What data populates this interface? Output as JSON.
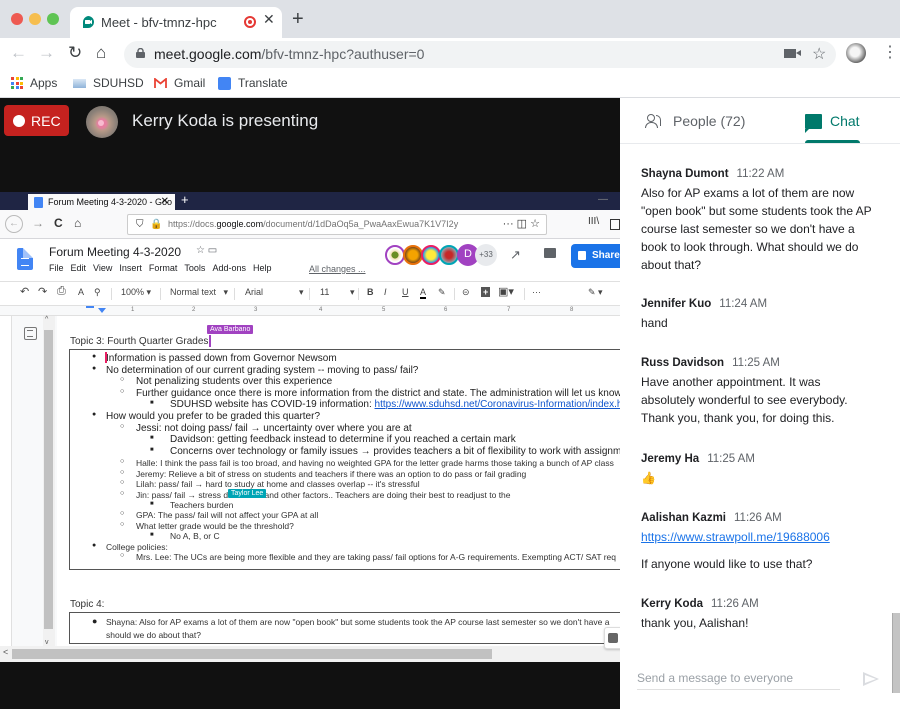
{
  "browser": {
    "tab_title": "Meet - bfv-tmnz-hpc",
    "close_symbol": "✕",
    "new_tab_symbol": "+",
    "url_host": "meet.google.com",
    "url_path": "/bfv-tmnz-hpc?authuser=0",
    "back_symbol": "←",
    "forward_symbol": "→",
    "reload_symbol": "↻",
    "home_symbol": "⌂",
    "star_symbol": "☆",
    "menu_symbol": "⋮",
    "bookmarks": [
      {
        "label": "Apps"
      },
      {
        "label": "SDUHSD"
      },
      {
        "label": "Gmail"
      },
      {
        "label": "Translate"
      }
    ]
  },
  "meet": {
    "rec_label": "REC",
    "presenting_text": "Kerry Koda is presenting",
    "colors": {
      "rec": "#c5221f",
      "accent": "#00796b"
    }
  },
  "shared_screen": {
    "firefox": {
      "tab_title": "Forum Meeting 4-3-2020 - Goo",
      "tab_close": "✕",
      "new_tab": "+",
      "minimize": "—",
      "back": "←",
      "forward": "→",
      "reload": "C",
      "home": "⌂",
      "url_prefix": "https://docs.",
      "url_host": "google.com",
      "url_rest": "/document/d/1dDaOq5a_PwaAaxEwua7K1V7I2y",
      "url_actions": "··· ◫ ☆",
      "library": "III\\"
    },
    "docs": {
      "title": "Forum Meeting 4-3-2020",
      "title_icons": "☆ ▭",
      "menu": [
        "File",
        "Edit",
        "View",
        "Insert",
        "Format",
        "Tools",
        "Add-ons",
        "Help"
      ],
      "all_changes": "All changes ...",
      "collaborators_more": "+33",
      "collaborator_letter": "D",
      "activity_symbol": "↗",
      "share_label": "Share",
      "toolbar": {
        "undo": "↶",
        "redo": "↷",
        "print": "⎙",
        "spell": "A",
        "paint": "⚲",
        "zoom": "100%",
        "style": "Normal text",
        "font": "Arial",
        "size": "11",
        "bold": "B",
        "italic": "I",
        "underline": "U",
        "color": "A",
        "highlight": "✎",
        "link": "⊝",
        "comment": "+",
        "image": "▣",
        "more": "···",
        "edit": "✎"
      },
      "ruler_numbers": [
        "1",
        "2",
        "3",
        "4",
        "5",
        "6",
        "7",
        "8"
      ],
      "topic3_label": "Topic 3:  Fourth Quarter Grades:",
      "topic3_items": [
        {
          "level": 0,
          "text": "Information is passed down from Governor Newsom"
        },
        {
          "level": 0,
          "text": "No determination of our current grading system -- moving to pass/ fail?"
        },
        {
          "level": 1,
          "text": "Not penalizing students over this experience"
        },
        {
          "level": 1,
          "text": "Further guidance once there is more information from the district and state. The administration will let us know"
        },
        {
          "level": 2,
          "text": "SDUHSD website has COVID-19 information: ",
          "link": "https://www.sduhsd.net/Coronavirus-Information/index.html"
        },
        {
          "level": 0,
          "text": "How would you prefer to be graded this quarter?"
        },
        {
          "level": 1,
          "text": "Jessi: not doing pass/ fail → uncertainty over where you are at"
        },
        {
          "level": 2,
          "text": "Davidson: getting feedback instead to determine if you reached a certain mark"
        },
        {
          "level": 2,
          "text": "Concerns over technology or family issues → provides teachers a bit of flexibility to work with assignments"
        },
        {
          "level": 1,
          "small": true,
          "text": "Halle: I think the pass fail is too broad, and having no weighted GPA for the letter grade harms those taking a bunch of AP class"
        },
        {
          "level": 1,
          "small": true,
          "text": "Jeremy: Relieve a bit of stress on students and teachers if there was an option to do pass or fail grading"
        },
        {
          "level": 1,
          "small": true,
          "text": "Lilah: pass/ fail → hard to study at home and classes overlap -- it's stressful"
        },
        {
          "level": 1,
          "small": true,
          "text": "Jin: pass/ fail → stress d            ituations and other factors.. Teachers are doing their best to readjust to the"
        },
        {
          "level": 2,
          "small": true,
          "text": "Teachers burden"
        },
        {
          "level": 1,
          "small": true,
          "text": "GPA: The pass/ fail will not affect your GPA at all"
        },
        {
          "level": 1,
          "small": true,
          "text": "What letter grade would be the threshold?"
        },
        {
          "level": 2,
          "small": true,
          "text": "No A, B, or C"
        },
        {
          "level": 0,
          "small": true,
          "text": "College policies:"
        },
        {
          "level": 1,
          "small": true,
          "text": "Mrs. Lee: The UCs are being more flexible and they are taking pass/ fail options for A-G requirements. Exempting ACT/ SAT req"
        }
      ],
      "topic4_label": "Topic 4:",
      "topic4_items": [
        {
          "text": "Shayna: Also for AP exams a lot of them are now \"open book\" but some students took the AP course last semester so we don't have a"
        },
        {
          "text": "should we do about that?"
        }
      ],
      "cursors": [
        {
          "name": "Ava Barbano",
          "color": "#a142c1"
        },
        {
          "name": "Taylor Lee",
          "color": "#00a5b5"
        }
      ],
      "scroll_up": "^",
      "scroll_down": "v",
      "scroll_left": "<"
    }
  },
  "panel": {
    "people_label": "People (72)",
    "chat_label": "Chat",
    "messages": [
      {
        "sender": "Shayna Dumont",
        "time": "11:22 AM",
        "body": [
          "Also for AP exams a lot of them are now \"open book\" but some students took the AP course last semester so we don't have a book to look through. What should we do about that?"
        ]
      },
      {
        "sender": "Jennifer Kuo",
        "time": "11:24 AM",
        "body": [
          "hand"
        ]
      },
      {
        "sender": "Russ Davidson",
        "time": "11:25 AM",
        "body": [
          "Have another appointment. It was absolutely wonderful to see everybody. Thank you, thank you, for doing this."
        ]
      },
      {
        "sender": "Jeremy Ha",
        "time": "11:25 AM",
        "body": [
          "👍"
        ]
      },
      {
        "sender": "Aalishan Kazmi",
        "time": "11:26 AM",
        "body": [
          "https://www.strawpoll.me/19688006",
          "If anyone would like to use that?"
        ]
      },
      {
        "sender": "Kerry Koda",
        "time": "11:26 AM",
        "body": [
          "thank you, Aalishan!"
        ]
      }
    ],
    "composer_placeholder": "Send a message to everyone"
  }
}
